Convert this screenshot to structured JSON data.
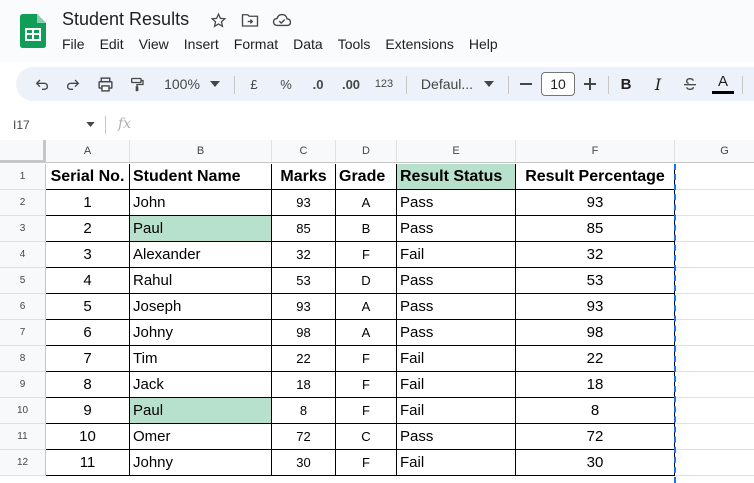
{
  "doc": {
    "title": "Student Results"
  },
  "menu": [
    "File",
    "Edit",
    "View",
    "Insert",
    "Format",
    "Data",
    "Tools",
    "Extensions",
    "Help"
  ],
  "toolbar": {
    "zoom": "100%",
    "currency": "£",
    "percent": "%",
    "dec_decrease": ".0",
    "dec_increase": ".00",
    "more_formats": "123",
    "font": "Defaul...",
    "font_size": "10",
    "bold": "B",
    "italic": "I",
    "text_color": "A"
  },
  "formula_bar": {
    "cell_ref": "I17",
    "fx_label": "fx"
  },
  "columns": [
    "A",
    "B",
    "C",
    "D",
    "E",
    "F",
    "G"
  ],
  "rows": [
    "1",
    "2",
    "3",
    "4",
    "5",
    "6",
    "7",
    "8",
    "9",
    "10",
    "11",
    "12"
  ],
  "table": {
    "headers": [
      "Serial No.",
      "Student  Name",
      "Marks",
      "Grade",
      "Result Status",
      "Result Percentage"
    ],
    "data": [
      [
        "1",
        "John",
        "93",
        "A",
        "Pass",
        "93"
      ],
      [
        "2",
        "Paul",
        "85",
        "B",
        "Pass",
        "85"
      ],
      [
        "3",
        "Alexander",
        "32",
        "F",
        "Fail",
        "32"
      ],
      [
        "4",
        "Rahul",
        "53",
        "D",
        "Pass",
        "53"
      ],
      [
        "5",
        "Joseph",
        "93",
        "A",
        "Pass",
        "93"
      ],
      [
        "6",
        "Johny",
        "98",
        "A",
        "Pass",
        "98"
      ],
      [
        "7",
        "Tim",
        "22",
        "F",
        "Fail",
        "22"
      ],
      [
        "8",
        "Jack",
        "18",
        "F",
        "Fail",
        "18"
      ],
      [
        "9",
        "Paul",
        "8",
        "F",
        "Fail",
        "8"
      ],
      [
        "10",
        "Omer",
        "72",
        "C",
        "Pass",
        "72"
      ],
      [
        "11",
        "Johny",
        "30",
        "F",
        "Fail",
        "30"
      ]
    ],
    "highlighted_rows": [
      1,
      8
    ]
  },
  "colors": {
    "highlight": "#b7e1cd",
    "header_green": "#b7e1cd",
    "accent": "#1a73e8"
  }
}
